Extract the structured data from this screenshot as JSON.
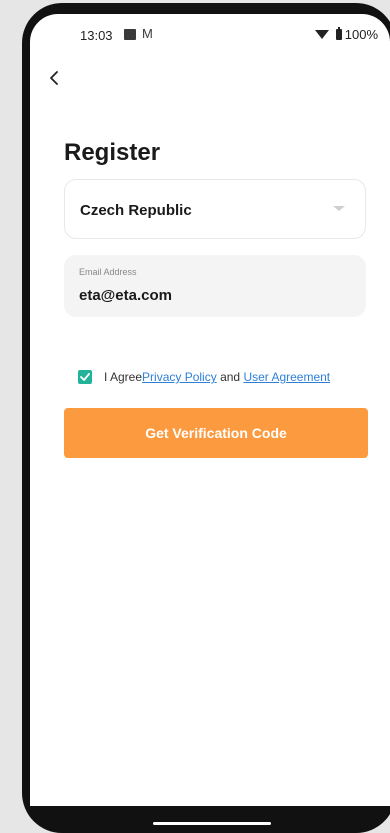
{
  "status_bar": {
    "time": "13:03",
    "notification_icon": "gmail-icon",
    "battery": "100%"
  },
  "header": {
    "back_icon": "chevron-left-icon",
    "title": "Register"
  },
  "form": {
    "country": {
      "value": "Czech Republic",
      "icon": "dropdown-arrow-icon"
    },
    "email": {
      "label": "Email Address",
      "value": "eta@eta.com"
    },
    "agreement": {
      "checked": true,
      "prefix": "I Agree",
      "privacy_link": "Privacy Policy",
      "conjunction": "and",
      "user_link": "User Agreement"
    },
    "submit_label": "Get Verification Code"
  },
  "colors": {
    "accent": "#fb9a3e",
    "checkbox": "#23b39b",
    "link": "#2f7fd6"
  }
}
